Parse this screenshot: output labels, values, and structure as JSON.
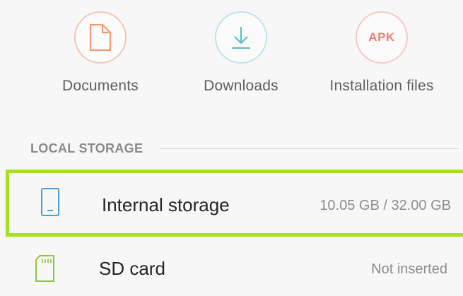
{
  "categories": [
    {
      "label": "Documents",
      "icon": "document-icon",
      "color": "#f19a73"
    },
    {
      "label": "Downloads",
      "icon": "download-icon",
      "color": "#5fbfc6"
    },
    {
      "label": "Installation files",
      "icon": "apk-icon",
      "icon_text": "APK",
      "color": "#f17b76"
    }
  ],
  "local_storage": {
    "header": "LOCAL STORAGE",
    "items": [
      {
        "title": "Internal storage",
        "value": "10.05 GB / 32.00 GB",
        "icon": "phone-icon",
        "icon_color": "#4a9fd8",
        "highlighted": true,
        "highlight_color": "#a5e11e"
      },
      {
        "title": "SD card",
        "value": "Not inserted",
        "icon": "sd-card-icon",
        "icon_color": "#8dc63f"
      }
    ]
  }
}
